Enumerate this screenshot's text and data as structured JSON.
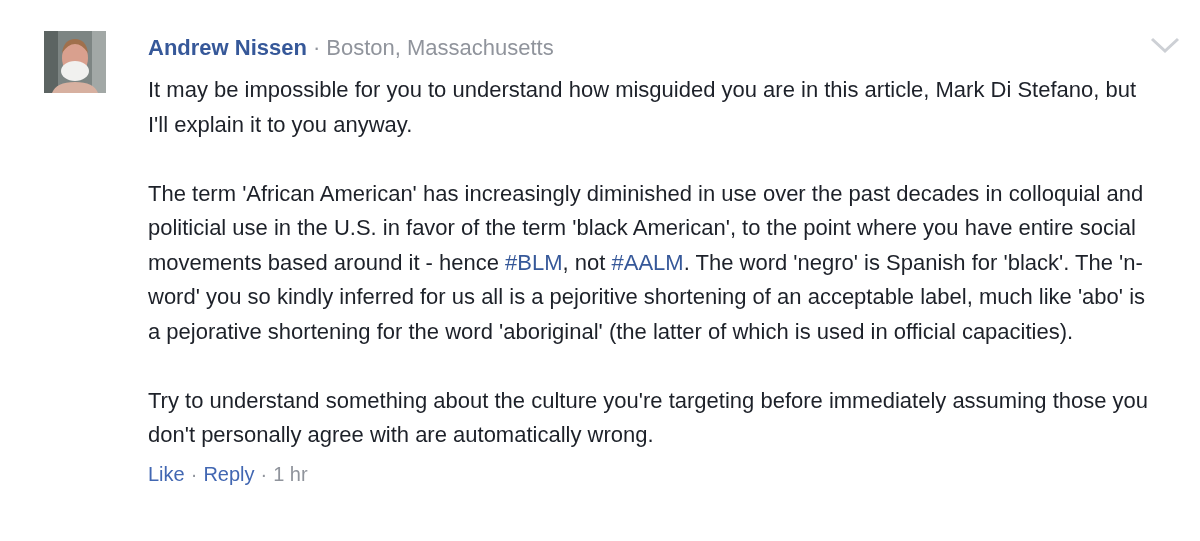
{
  "comment": {
    "author": "Andrew Nissen",
    "separator": "·",
    "location": "Boston, Massachusetts",
    "paragraphs": [
      [
        {
          "kind": "text",
          "text": "It may be impossible for you to understand how misguided you are in this article, Mark Di Stefano, but I'll explain it to you anyway."
        }
      ],
      [
        {
          "kind": "text",
          "text": "The term 'African American' has increasingly diminished in use over the past decades in colloquial and politicial use in the U.S. in favor of the term 'black American', to the point where you have entire social movements based around it - hence "
        },
        {
          "kind": "link",
          "text": "#BLM"
        },
        {
          "kind": "text",
          "text": ", not "
        },
        {
          "kind": "link",
          "text": "#AALM"
        },
        {
          "kind": "text",
          "text": ". The word 'negro' is Spanish for 'black'. The 'n-word' you so kindly inferred for us all is a pejoritive shortening of an acceptable label, much like 'abo' is a pejorative shortening for the word 'aboriginal' (the latter of which is used in official capacities)."
        }
      ],
      [
        {
          "kind": "text",
          "text": "Try to understand something about the culture you're targeting before immediately assuming those you don't personally agree with are automatically wrong."
        }
      ]
    ],
    "actions": [
      {
        "kind": "link",
        "text": "Like"
      },
      {
        "kind": "separator",
        "text": "·"
      },
      {
        "kind": "link",
        "text": "Reply"
      },
      {
        "kind": "separator",
        "text": "·"
      },
      {
        "kind": "time",
        "text": "1 hr"
      }
    ]
  }
}
